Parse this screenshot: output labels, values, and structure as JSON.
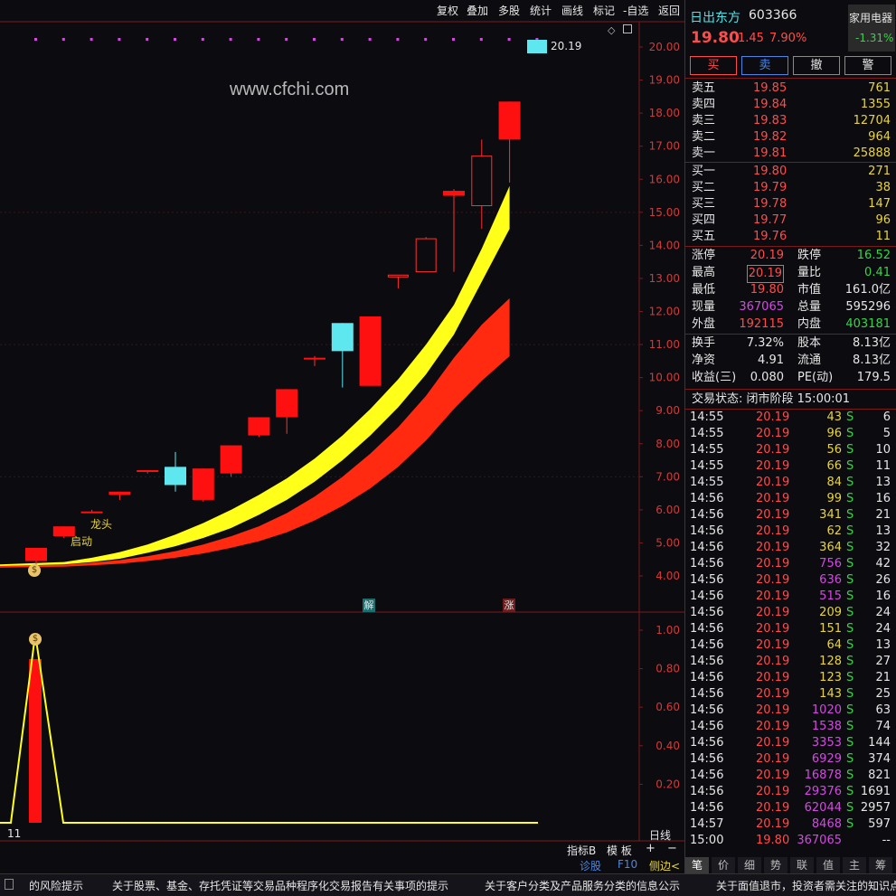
{
  "toolbar": {
    "buttons": [
      "复权",
      "叠加",
      "多股",
      "统计",
      "画线",
      "标记",
      "-自选",
      "返回"
    ]
  },
  "main_chart": {
    "watermark": "www.cfchi.com",
    "y_ticks": [
      "20.00",
      "19.00",
      "18.00",
      "17.00",
      "16.00",
      "15.00",
      "14.00",
      "13.00",
      "12.00",
      "11.00",
      "10.00",
      "9.00",
      "8.00",
      "7.00",
      "6.00",
      "5.00",
      "4.00"
    ],
    "y_range": [
      3.3,
      20.8
    ],
    "last_price_label": "20.19",
    "label_longtou": "龙头",
    "label_qidong": "启动",
    "marker_jie": "解",
    "marker_zhang": "涨",
    "candles": [
      {
        "o": 4.45,
        "h": 4.75,
        "l": 4.3,
        "c": 4.85
      },
      {
        "o": 5.2,
        "h": 5.45,
        "l": 5.15,
        "c": 5.5
      },
      {
        "o": 5.93,
        "h": 6.0,
        "l": 5.9,
        "c": 5.95
      },
      {
        "o": 6.45,
        "h": 6.5,
        "l": 6.3,
        "c": 6.55
      },
      {
        "o": 7.15,
        "h": 7.2,
        "l": 7.1,
        "c": 7.2
      },
      {
        "o": 7.3,
        "h": 7.75,
        "l": 6.55,
        "c": 6.75
      },
      {
        "o": 6.3,
        "h": 7.25,
        "l": 6.25,
        "c": 7.25
      },
      {
        "o": 7.1,
        "h": 7.85,
        "l": 7.0,
        "c": 7.95
      },
      {
        "o": 8.25,
        "h": 8.8,
        "l": 8.2,
        "c": 8.8
      },
      {
        "o": 8.8,
        "h": 9.6,
        "l": 8.3,
        "c": 9.65
      },
      {
        "o": 10.55,
        "h": 10.65,
        "l": 10.35,
        "c": 10.6
      },
      {
        "o": 11.65,
        "h": 11.65,
        "l": 9.7,
        "c": 10.8
      },
      {
        "o": 9.75,
        "h": 11.85,
        "l": 9.75,
        "c": 11.85
      },
      {
        "o": 13.1,
        "h": 13.1,
        "l": 12.7,
        "c": 13.1
      },
      {
        "o": 13.2,
        "h": 14.25,
        "l": 13.2,
        "c": 14.2
      },
      {
        "o": 15.5,
        "h": 15.7,
        "l": 13.2,
        "c": 15.65
      },
      {
        "o": 15.2,
        "h": 17.2,
        "l": 14.5,
        "c": 16.7
      },
      {
        "o": 17.2,
        "h": 17.2,
        "l": 15.9,
        "c": 18.35
      }
    ],
    "upper_band_top": [
      4.35,
      4.42,
      4.55,
      4.72,
      4.95,
      5.25,
      5.6,
      6.0,
      6.45,
      6.95,
      7.55,
      8.25,
      9.05,
      9.95,
      11.0,
      12.2,
      13.9,
      15.8
    ],
    "upper_band_bot": [
      4.3,
      4.35,
      4.42,
      4.52,
      4.7,
      4.9,
      5.15,
      5.45,
      5.85,
      6.3,
      6.85,
      7.5,
      8.25,
      9.1,
      10.1,
      11.3,
      12.9,
      14.5
    ],
    "lower_band_top": [
      4.3,
      4.34,
      4.4,
      4.48,
      4.6,
      4.75,
      4.95,
      5.2,
      5.5,
      5.9,
      6.4,
      7.0,
      7.7,
      8.5,
      9.45,
      10.6,
      11.6,
      12.4
    ],
    "lower_band_bot": [
      4.25,
      4.28,
      4.32,
      4.37,
      4.45,
      4.55,
      4.68,
      4.85,
      5.05,
      5.32,
      5.68,
      6.12,
      6.65,
      7.3,
      8.1,
      9.05,
      9.9,
      10.65
    ]
  },
  "sub_chart": {
    "y_ticks": [
      "1.00",
      "0.80",
      "0.60",
      "0.40",
      "0.20"
    ],
    "period_label": "日线",
    "bottom_left_label": "11"
  },
  "chart_controls": {
    "indicator_b": "指标B",
    "template": "模 板",
    "plus": "+",
    "minus": "−"
  },
  "status_links": {
    "diagnose": "诊股",
    "f10": "F10",
    "side": "侧边<"
  },
  "quote": {
    "name": "日出东方",
    "code": "603366",
    "sector": "家用电器",
    "sector_change": "-1.31%",
    "price": "19.80",
    "change": "1.45",
    "change_pct": "7.90%",
    "btn_buy": "买",
    "btn_sell": "卖",
    "btn_cancel": "撤",
    "btn_alert": "警"
  },
  "asks": [
    {
      "label": "卖五",
      "price": "19.85",
      "vol": "761"
    },
    {
      "label": "卖四",
      "price": "19.84",
      "vol": "1355"
    },
    {
      "label": "卖三",
      "price": "19.83",
      "vol": "12704"
    },
    {
      "label": "卖二",
      "price": "19.82",
      "vol": "964"
    },
    {
      "label": "卖一",
      "price": "19.81",
      "vol": "25888"
    }
  ],
  "bids": [
    {
      "label": "买一",
      "price": "19.80",
      "vol": "271"
    },
    {
      "label": "买二",
      "price": "19.79",
      "vol": "38"
    },
    {
      "label": "买三",
      "price": "19.78",
      "vol": "147"
    },
    {
      "label": "买四",
      "price": "19.77",
      "vol": "96"
    },
    {
      "label": "买五",
      "price": "19.76",
      "vol": "11"
    }
  ],
  "stats": {
    "limit_up_label": "涨停",
    "limit_up": "20.19",
    "limit_down_label": "跌停",
    "limit_down": "16.52",
    "high_label": "最高",
    "high": "20.19",
    "vol_ratio_label": "量比",
    "vol_ratio": "0.41",
    "low_label": "最低",
    "low": "19.80",
    "mkt_cap_label": "市值",
    "mkt_cap": "161.0亿",
    "cur_vol_label": "现量",
    "cur_vol": "367065",
    "total_vol_label": "总量",
    "total_vol": "595296",
    "outer_label": "外盘",
    "outer": "192115",
    "inner_label": "内盘",
    "inner": "403181",
    "turnover_label": "换手",
    "turnover": "7.32%",
    "shares_label": "股本",
    "shares": "8.13亿",
    "nav_label": "净资",
    "nav": "4.91",
    "float_label": "流通",
    "float": "8.13亿",
    "eps_label": "收益(三)",
    "eps": "0.080",
    "pe_label": "PE(动)",
    "pe": "179.5"
  },
  "trade_status": "交易状态: 闭市阶段 15:00:01",
  "ticks": [
    {
      "t": "14:55",
      "p": "20.19",
      "v": "43",
      "vc": "y",
      "n": "6"
    },
    {
      "t": "14:55",
      "p": "20.19",
      "v": "96",
      "vc": "y",
      "n": "5"
    },
    {
      "t": "14:55",
      "p": "20.19",
      "v": "56",
      "vc": "y",
      "n": "10"
    },
    {
      "t": "14:55",
      "p": "20.19",
      "v": "66",
      "vc": "y",
      "n": "11"
    },
    {
      "t": "14:55",
      "p": "20.19",
      "v": "84",
      "vc": "y",
      "n": "13"
    },
    {
      "t": "14:56",
      "p": "20.19",
      "v": "99",
      "vc": "y",
      "n": "16"
    },
    {
      "t": "14:56",
      "p": "20.19",
      "v": "341",
      "vc": "y",
      "n": "21"
    },
    {
      "t": "14:56",
      "p": "20.19",
      "v": "62",
      "vc": "y",
      "n": "13"
    },
    {
      "t": "14:56",
      "p": "20.19",
      "v": "364",
      "vc": "y",
      "n": "32"
    },
    {
      "t": "14:56",
      "p": "20.19",
      "v": "756",
      "vc": "p",
      "n": "42"
    },
    {
      "t": "14:56",
      "p": "20.19",
      "v": "636",
      "vc": "p",
      "n": "26"
    },
    {
      "t": "14:56",
      "p": "20.19",
      "v": "515",
      "vc": "p",
      "n": "16"
    },
    {
      "t": "14:56",
      "p": "20.19",
      "v": "209",
      "vc": "y",
      "n": "24"
    },
    {
      "t": "14:56",
      "p": "20.19",
      "v": "151",
      "vc": "y",
      "n": "24"
    },
    {
      "t": "14:56",
      "p": "20.19",
      "v": "64",
      "vc": "y",
      "n": "13"
    },
    {
      "t": "14:56",
      "p": "20.19",
      "v": "128",
      "vc": "y",
      "n": "27"
    },
    {
      "t": "14:56",
      "p": "20.19",
      "v": "123",
      "vc": "y",
      "n": "21"
    },
    {
      "t": "14:56",
      "p": "20.19",
      "v": "143",
      "vc": "y",
      "n": "25"
    },
    {
      "t": "14:56",
      "p": "20.19",
      "v": "1020",
      "vc": "p",
      "n": "63"
    },
    {
      "t": "14:56",
      "p": "20.19",
      "v": "1538",
      "vc": "p",
      "n": "74"
    },
    {
      "t": "14:56",
      "p": "20.19",
      "v": "3353",
      "vc": "p",
      "n": "144"
    },
    {
      "t": "14:56",
      "p": "20.19",
      "v": "6929",
      "vc": "p",
      "n": "374"
    },
    {
      "t": "14:56",
      "p": "20.19",
      "v": "16878",
      "vc": "p",
      "n": "821"
    },
    {
      "t": "14:56",
      "p": "20.19",
      "v": "29376",
      "vc": "p",
      "n": "1691"
    },
    {
      "t": "14:56",
      "p": "20.19",
      "v": "62044",
      "vc": "p",
      "n": "2957"
    },
    {
      "t": "14:57",
      "p": "20.19",
      "v": "8468",
      "vc": "p",
      "n": "597"
    },
    {
      "t": "15:00",
      "p": "19.80",
      "v": "367065",
      "vc": "p",
      "n": "--"
    }
  ],
  "tick_flag": "S",
  "right_tabs": [
    "笔",
    "价",
    "细",
    "势",
    "联",
    "值",
    "主",
    "筹"
  ],
  "ticker_items": [
    "的风险提示",
    "关于股票、基金、存托凭证等交易品种程序化交易报告有关事项的提示",
    "关于客户分类及产品服务分类的信息公示",
    "关于面值退市，投资者需关注的知识点"
  ]
}
